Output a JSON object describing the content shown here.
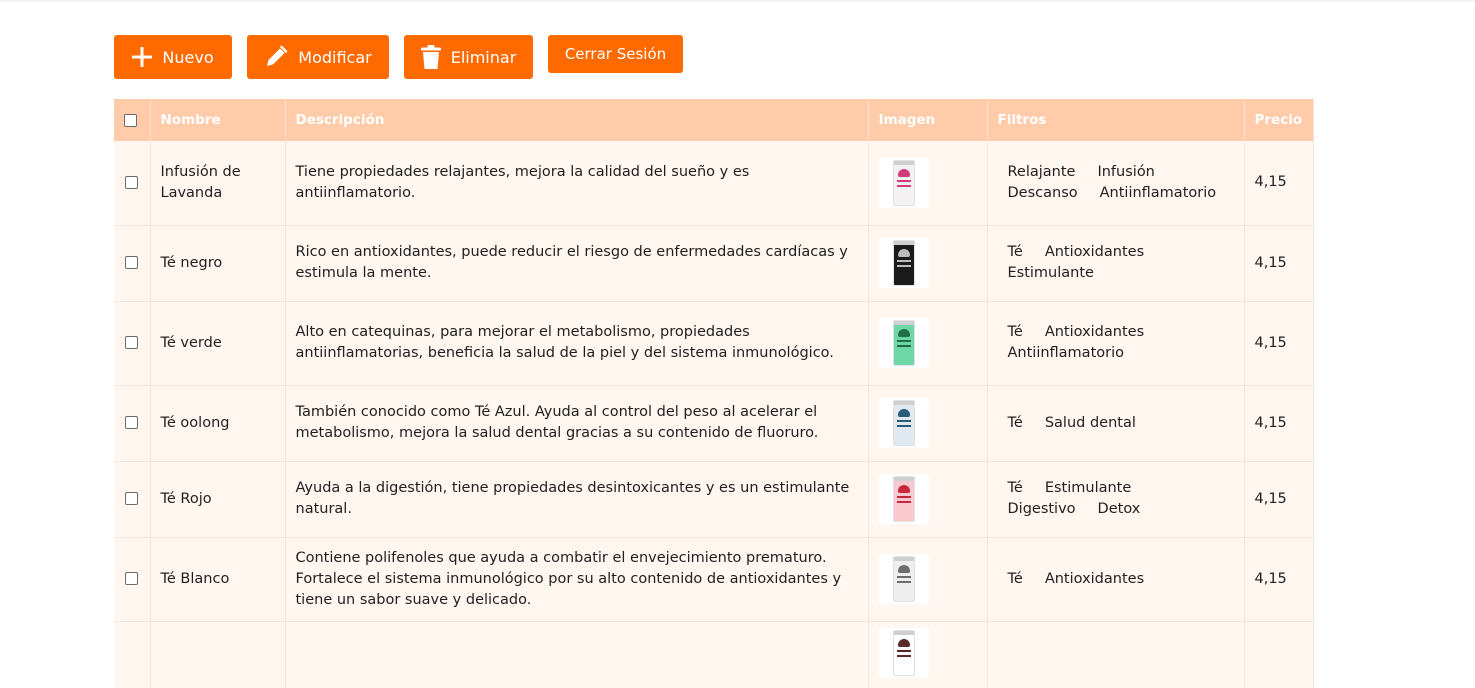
{
  "toolbar": {
    "new_label": "Nuevo",
    "edit_label": "Modificar",
    "delete_label": "Eliminar",
    "logout_label": "Cerrar Sesión"
  },
  "colors": {
    "accent": "#ff6a00",
    "header_bg": "#ffcba9",
    "row_bg": "#fff6f0"
  },
  "table": {
    "headers": {
      "name": "Nombre",
      "description": "Descripción",
      "image": "Imagen",
      "filters": "Filtros",
      "price": "Precio"
    },
    "rows": [
      {
        "name": "Infusión de Lavanda",
        "description": "Tiene propiedades relajantes, mejora la calidad del sueño y es antiinflamatorio.",
        "tags": [
          "Relajante",
          "Infusión",
          "Descanso",
          "Antiinflamatorio"
        ],
        "price": "4,15",
        "can_color": "#f4f1f3",
        "leaf_color": "#d23c7a"
      },
      {
        "name": "Té negro",
        "description": "Rico en antioxidantes, puede reducir el riesgo de enfermedades cardíacas y estimula la mente.",
        "tags": [
          "Té",
          "Antioxidantes",
          "Estimulante"
        ],
        "price": "4,15",
        "can_color": "#1b1b1b",
        "leaf_color": "#bcbcbc"
      },
      {
        "name": "Té verde",
        "description": "Alto en catequinas, para mejorar el metabolismo, propiedades antiinflamatorias, beneficia la salud de la piel y del sistema inmunológico.",
        "tags": [
          "Té",
          "Antioxidantes",
          "Antiinflamatorio"
        ],
        "price": "4,15",
        "can_color": "#6fd7a5",
        "leaf_color": "#1f6e45"
      },
      {
        "name": "Té oolong",
        "description": "También conocido como Té Azul. Ayuda al control del peso al acelerar el metabolismo, mejora la salud dental gracias a su contenido de fluoruro.",
        "tags": [
          "Té",
          "Salud dental"
        ],
        "price": "4,15",
        "can_color": "#dfe9ef",
        "leaf_color": "#2c5a79"
      },
      {
        "name": "Té Rojo",
        "description": "Ayuda a la digestión, tiene propiedades desintoxicantes y es un estimulante natural.",
        "tags": [
          "Té",
          "Estimulante",
          "Digestivo",
          "Detox"
        ],
        "price": "4,15",
        "can_color": "#f9c9cf",
        "leaf_color": "#c5283a"
      },
      {
        "name": "Té Blanco",
        "description": "Contiene polifenoles que ayuda a combatir el envejecimiento prematuro. Fortalece el sistema inmunológico por su alto contenido de antioxidantes y tiene un sabor suave y delicado.",
        "tags": [
          "Té",
          "Antioxidantes"
        ],
        "price": "4,15",
        "can_color": "#eeeeee",
        "leaf_color": "#6d6d6d"
      },
      {
        "name": "",
        "description": "",
        "tags": [],
        "price": "",
        "can_color": "#ffffff",
        "leaf_color": "#5a2a2a"
      }
    ]
  }
}
